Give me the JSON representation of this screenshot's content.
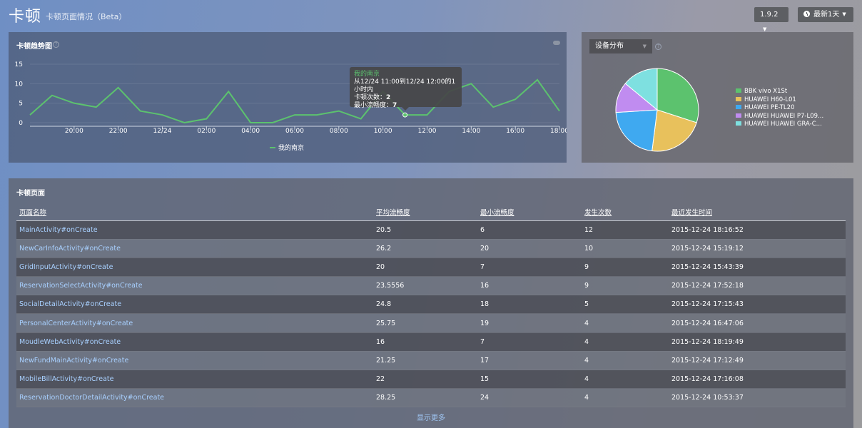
{
  "header": {
    "title": "卡顿",
    "subtitle": "卡顿页面情况（Beta）",
    "version_label": "1.9.2",
    "time_range_label": "最新1天"
  },
  "trend": {
    "title": "卡顿趋势图",
    "tooltip": {
      "series": "我的南京",
      "line1": "从12/24 11:00到12/24 12:00的1小时内",
      "count_label": "卡顿次数：",
      "count_value": "2",
      "fluency_label": "最小流畅度：",
      "fluency_value": "7"
    }
  },
  "chart_data": {
    "type": "line",
    "ylim": [
      0,
      15
    ],
    "yticks": [
      "0",
      "5",
      "10",
      "15"
    ],
    "xtick_labels": [
      "20:00",
      "22:00",
      "12/24",
      "02:00",
      "04:00",
      "06:00",
      "08:00",
      "10:00",
      "12:00",
      "14:00",
      "16:00",
      "18:00"
    ],
    "series": [
      {
        "name": "我的南京",
        "color": "#5cc26e",
        "values": [
          2,
          7,
          5,
          4,
          9,
          3,
          2,
          0,
          1,
          8,
          0,
          0,
          2,
          2,
          3,
          1,
          8,
          2,
          2,
          8,
          10,
          4,
          6,
          11,
          3
        ]
      }
    ]
  },
  "device": {
    "select_label": "设备分布",
    "pie": [
      {
        "name": "BBK vivo X1St",
        "value": 30,
        "color": "#5cc26e"
      },
      {
        "name": "HUAWEI H60-L01",
        "value": 22,
        "color": "#e8c15c"
      },
      {
        "name": "HUAWEI PE-TL20",
        "value": 22,
        "color": "#3fa9f0"
      },
      {
        "name": "HUAWEI HUAWEI P7-L09...",
        "value": 12,
        "color": "#c08cf0"
      },
      {
        "name": "HUAWEI HUAWEI GRA-C...",
        "value": 14,
        "color": "#7ee0e0"
      }
    ]
  },
  "table": {
    "title": "卡顿页面",
    "columns": [
      "页面名称",
      "平均流畅度",
      "最小流畅度",
      "发生次数",
      "最近发生时间"
    ],
    "rows": [
      [
        "MainActivity#onCreate",
        "20.5",
        "6",
        "12",
        "2015-12-24 18:16:52"
      ],
      [
        "NewCarInfoActivity#onCreate",
        "26.2",
        "20",
        "10",
        "2015-12-24 15:19:12"
      ],
      [
        "GridInputActivity#onCreate",
        "20",
        "7",
        "9",
        "2015-12-24 15:43:39"
      ],
      [
        "ReservationSelectActivity#onCreate",
        "23.5556",
        "16",
        "9",
        "2015-12-24 17:52:18"
      ],
      [
        "SocialDetailActivity#onCreate",
        "24.8",
        "18",
        "5",
        "2015-12-24 17:15:43"
      ],
      [
        "PersonalCenterActivity#onCreate",
        "25.75",
        "19",
        "4",
        "2015-12-24 16:47:06"
      ],
      [
        "MoudleWebActivity#onCreate",
        "16",
        "7",
        "4",
        "2015-12-24 18:19:49"
      ],
      [
        "NewFundMainActivity#onCreate",
        "21.25",
        "17",
        "4",
        "2015-12-24 17:12:49"
      ],
      [
        "MobileBillActivity#onCreate",
        "22",
        "15",
        "4",
        "2015-12-24 17:16:08"
      ],
      [
        "ReservationDoctorDetailActivity#onCreate",
        "28.25",
        "24",
        "4",
        "2015-12-24 10:53:37"
      ]
    ],
    "show_more": "显示更多"
  }
}
